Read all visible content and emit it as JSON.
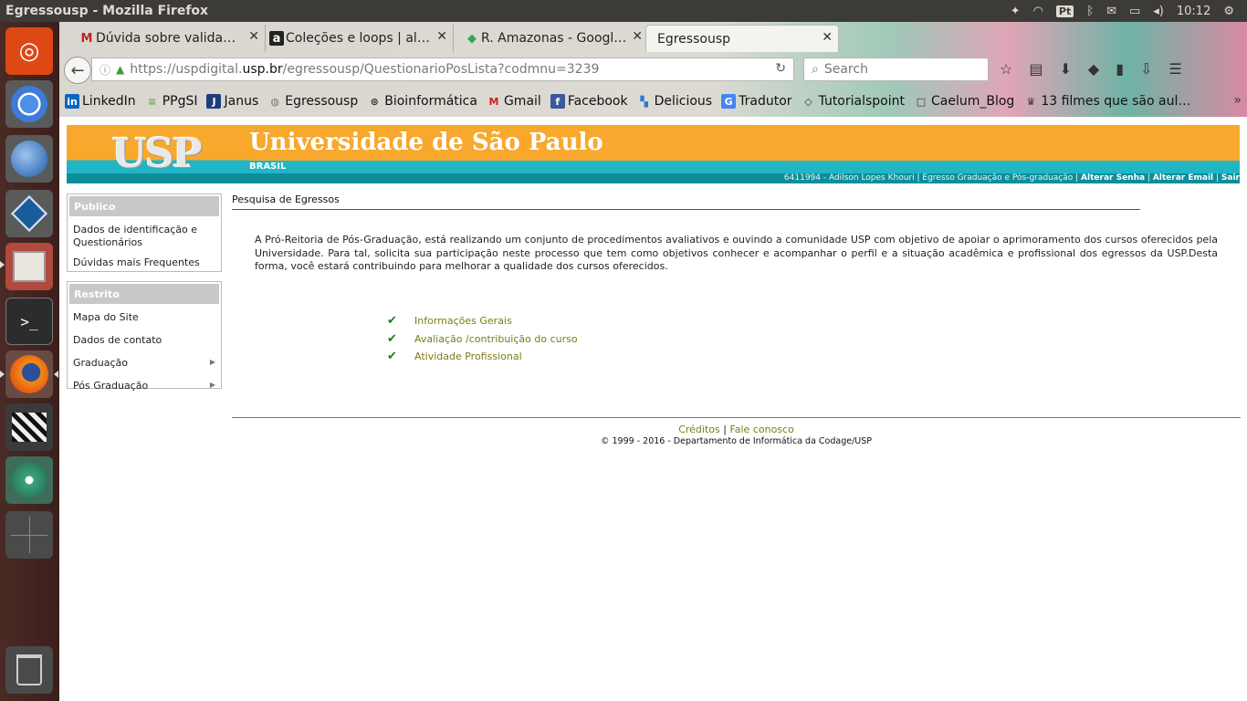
{
  "window": {
    "title": "Egressousp - Mozilla Firefox"
  },
  "tray": {
    "pt": "Pt",
    "clock": "10:12"
  },
  "launcher": {
    "items": [
      "ubuntu-dash",
      "chromium",
      "thunderbird",
      "virtualbox",
      "files",
      "terminal",
      "firefox",
      "video-editor",
      "atom",
      "workspaces",
      "trash"
    ]
  },
  "tabs": [
    {
      "label": "Dúvida sobre valida…",
      "fav": "M",
      "fav_color": "#c5221f"
    },
    {
      "label": "Coleções e loops | al…",
      "fav": "a",
      "fav_color": "#222222"
    },
    {
      "label": "R. Amazonas - Googl…",
      "fav": "◆",
      "fav_color": "#34a853"
    },
    {
      "label": "Egressousp",
      "fav": "",
      "fav_color": "#777777"
    }
  ],
  "url": {
    "prefix": "https://uspdigital.",
    "host": "usp.br",
    "suffix": "/egressousp/QuestionarioPosLista?codmnu=3239"
  },
  "search": {
    "placeholder": "Search"
  },
  "bookmarks": [
    {
      "label": "LinkedIn",
      "icon": "in",
      "color": "#0a66c2"
    },
    {
      "label": "PPgSI",
      "icon": "≡",
      "color": "#6aa84f"
    },
    {
      "label": "Janus",
      "icon": "J",
      "color": "#1c3d7a"
    },
    {
      "label": "Egressousp",
      "icon": "◍",
      "color": "#777777"
    },
    {
      "label": "Bioinformática",
      "icon": "⊛",
      "color": "#333333"
    },
    {
      "label": "Gmail",
      "icon": "M",
      "color": "#c5221f"
    },
    {
      "label": "Facebook",
      "icon": "f",
      "color": "#3b5998"
    },
    {
      "label": "Delicious",
      "icon": "▚",
      "color": "#3274d1"
    },
    {
      "label": "Tradutor",
      "icon": "G",
      "color": "#4285f4"
    },
    {
      "label": "Tutorialspoint",
      "icon": "◇",
      "color": "#333333"
    },
    {
      "label": "Caelum_Blog",
      "icon": "□",
      "color": "#333333"
    },
    {
      "label": "13 filmes que são aul…",
      "icon": "♛",
      "color": "#333333"
    }
  ],
  "usp": {
    "logo": "USP",
    "title": "Universidade de São Paulo",
    "country": "BRASIL",
    "user_info": "6411994 - Adilson Lopes Khouri | Egresso Graduação e Pós-graduação | ",
    "alterar_senha": "Alterar Senha",
    "alterar_email": "Alterar Email",
    "sair": "Sair"
  },
  "sidebar": {
    "publico": {
      "heading": "Publico",
      "items": [
        "Dados de identificação e Questionários",
        "Dúvidas mais Frequentes"
      ]
    },
    "restrito": {
      "heading": "Restrito",
      "items": [
        "Mapa do Site",
        "Dados de contato",
        "Graduação",
        "Pós Graduação"
      ]
    }
  },
  "main": {
    "title": "Pesquisa de Egressos",
    "intro": "A Pró-Reitoria de Pós-Graduação, está realizando um conjunto de procedimentos avaliativos e ouvindo a comunidade USP com objetivo de apoiar o aprimoramento dos cursos oferecidos pela Universidade. Para tal, solicita sua participação neste processo que tem como objetivos conhecer e acompanhar o perfil e a situação acadêmica e profissional dos egressos da USP.Desta forma, você estará contribuindo para melhorar a qualidade dos cursos oferecidos.",
    "checklist": [
      "Informações Gerais",
      "Avaliação /contribuição do curso",
      "Atividade Profissional"
    ]
  },
  "footer": {
    "creditos": "Créditos",
    "sep": " | ",
    "fale": "Fale conosco",
    "copyright": "© 1999 - 2016 - Departamento de Informática da Codage/USP"
  }
}
